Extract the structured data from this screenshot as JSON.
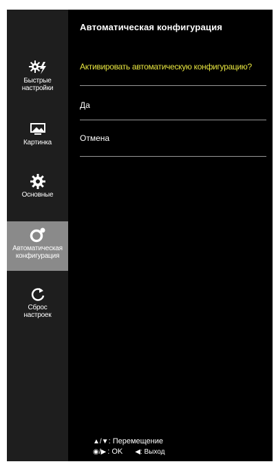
{
  "sidebar": {
    "items": [
      {
        "label": "Быстрые\nнастройки",
        "icon": "quick-settings-icon"
      },
      {
        "label": "Картинка",
        "icon": "picture-icon"
      },
      {
        "label": "Основные",
        "icon": "gear-icon"
      },
      {
        "label": "Автоматическая\nконфигурация",
        "icon": "auto-config-icon",
        "active": true
      },
      {
        "label": "Сброс\nнастроек",
        "icon": "reset-icon"
      }
    ]
  },
  "main": {
    "title": "Автоматическая конфигурация",
    "question": "Активировать автоматическую конфигурацию?",
    "options": [
      "Да",
      "Отмена"
    ]
  },
  "footer": {
    "move_symbol": "▲/▼",
    "move_label": ": Перемещение",
    "ok_symbol": "◉/▶",
    "ok_label": ": OK",
    "exit_symbol": "◀",
    "exit_label": ": Выход"
  },
  "colors": {
    "accent_yellow": "#e8e640",
    "active_item_bg": "#8a8a8a",
    "sidebar_bg": "#1e1e1e"
  }
}
